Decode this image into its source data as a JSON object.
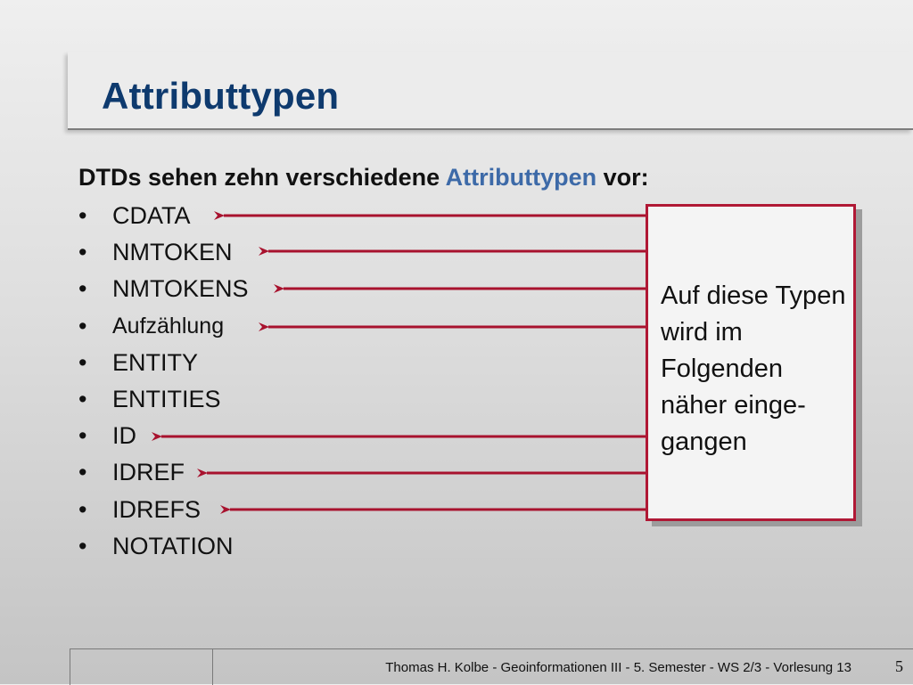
{
  "slide": {
    "title": "Attributtypen",
    "intro_before": "DTDs sehen zehn verschiedene ",
    "intro_highlight": "Attributtypen",
    "intro_after": " vor:",
    "bullet": "•",
    "types": [
      {
        "label": "CDATA",
        "arrow": true
      },
      {
        "label": "NMTOKEN",
        "arrow": true
      },
      {
        "label": "NMTOKENS",
        "arrow": true
      },
      {
        "label": "Aufzählung",
        "arrow": true
      },
      {
        "label": "ENTITY",
        "arrow": false
      },
      {
        "label": "ENTITIES",
        "arrow": false
      },
      {
        "label": "ID",
        "arrow": true
      },
      {
        "label": "IDREF",
        "arrow": true
      },
      {
        "label": "IDREFS",
        "arrow": true
      },
      {
        "label": "NOTATION",
        "arrow": false
      }
    ],
    "note": "Auf diese Typen wird im Folgenden näher einge-gangen",
    "footer": "Thomas H. Kolbe  -  Geoinformationen III  -  5. Semester  -  WS 2/3  -  Vorlesung 13",
    "page_number": "5"
  },
  "colors": {
    "title": "#0e3a6e",
    "highlight": "#3d6aa8",
    "arrow": "#a8122e",
    "note_border": "#b01835"
  }
}
